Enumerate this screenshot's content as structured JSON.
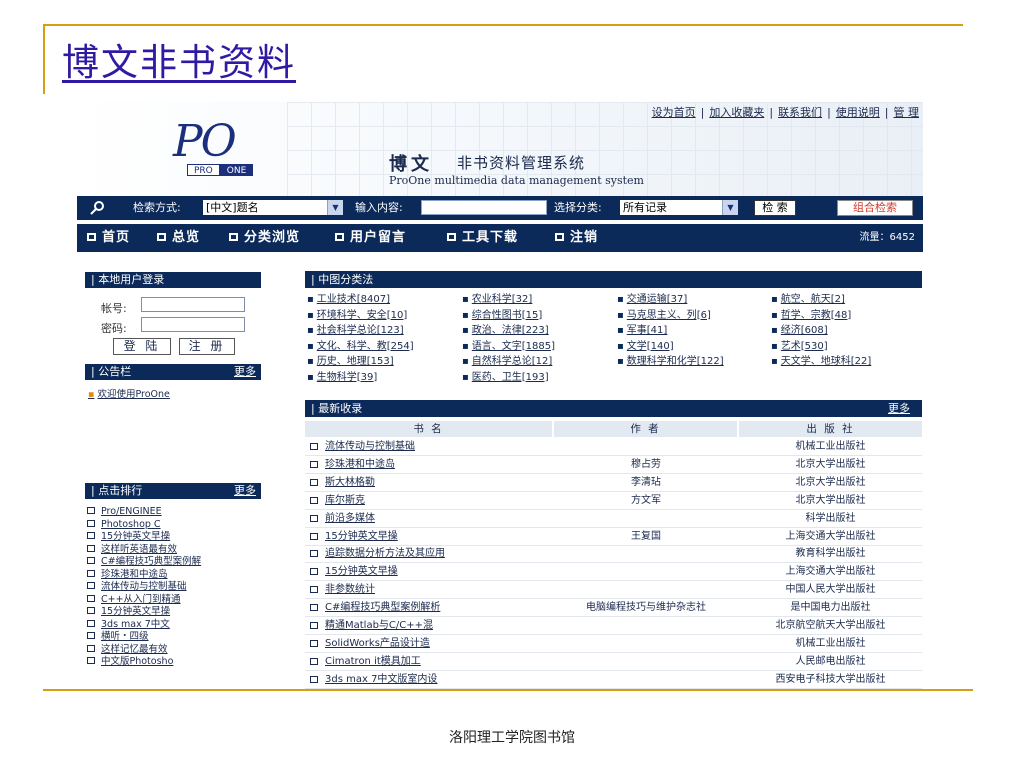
{
  "slide": {
    "title": "博文非书资料",
    "footer": "洛阳理工学院图书馆"
  },
  "app": {
    "logo_text": "PO",
    "logo_pro": "PRO",
    "logo_one": "ONE",
    "brand_name": "博文",
    "brand_subtitle": "非书资料管理系统",
    "brand_english": "ProOne  multimedia data management system",
    "top_links": [
      "设为首页",
      "加入收藏夹",
      "联系我们",
      "使用说明",
      "管 理"
    ]
  },
  "search": {
    "mode_label": "检索方式:",
    "mode_value": "[中文]题名",
    "input_label": "输入内容:",
    "input_value": "",
    "category_label": "选择分类:",
    "category_value": "所有记录",
    "search_button": "检 索",
    "combo_button": "组合检索"
  },
  "nav": {
    "items": [
      "首页",
      "总览",
      "分类浏览",
      "用户留言",
      "工具下载",
      "注销"
    ],
    "traffic": "流量：6452"
  },
  "login": {
    "header": "本地用户登录",
    "account_label": "帐号:",
    "password_label": "密码:",
    "login_button": "登 陆",
    "register_button": "注 册"
  },
  "notice": {
    "header": "公告栏",
    "more": "更多",
    "items": [
      "欢迎使用ProOne"
    ]
  },
  "ranking": {
    "header": "点击排行",
    "more": "更多",
    "items": [
      "Pro/ENGINEE",
      "Photoshop C",
      "15分钟英文早操",
      "这样听英语最有效",
      "C#编程技巧典型案例解",
      "珍珠港和中途岛",
      "流体传动与控制基础",
      "C++从入门到精通",
      "15分钟英文早操",
      "3ds max 7中文",
      "横听・四级",
      "这样记忆最有效",
      "中文版Photosho"
    ]
  },
  "categories": {
    "header": "中图分类法",
    "items": [
      "工业技术[8407]",
      "农业科学[32]",
      "交通运输[37]",
      "航空、航天[2]",
      "环境科学、安全[10]",
      "综合性图书[15]",
      "马克思主义、列[6]",
      "哲学、宗教[48]",
      "社会科学总论[123]",
      "政治、法律[223]",
      "军事[41]",
      "经济[608]",
      "文化、科学、教[254]",
      "语言、文字[1885]",
      "文学[140]",
      "艺术[530]",
      "历史、地理[153]",
      "自然科学总论[12]",
      "数理科学和化学[122]",
      "天文学、地球科[22]",
      "生物科学[39]",
      "医药、卫生[193]"
    ]
  },
  "latest": {
    "header": "最新收录",
    "more": "更多",
    "columns": {
      "title": "书 名",
      "author": "作 者",
      "publisher": "出 版 社"
    },
    "rows": [
      {
        "title": "流体传动与控制基础",
        "author": "",
        "publisher": "机械工业出版社"
      },
      {
        "title": "珍珠港和中途岛",
        "author": "穆占劳",
        "publisher": "北京大学出版社"
      },
      {
        "title": "斯大林格勒",
        "author": "李清玷",
        "publisher": "北京大学出版社"
      },
      {
        "title": "库尔斯克",
        "author": "方文军",
        "publisher": "北京大学出版社"
      },
      {
        "title": "前沿多媒体",
        "author": "",
        "publisher": "科学出版社"
      },
      {
        "title": "15分钟英文早操",
        "author": "王复国",
        "publisher": "上海交通大学出版社"
      },
      {
        "title": "追踪数据分析方法及其应用",
        "author": "",
        "publisher": "教育科学出版社"
      },
      {
        "title": "15分钟英文早操",
        "author": "",
        "publisher": "上海交通大学出版社"
      },
      {
        "title": "非参数统计",
        "author": "",
        "publisher": "中国人民大学出版社"
      },
      {
        "title": "C#编程技巧典型案例解析",
        "author": "电脑编程技巧与维护杂志社",
        "publisher": "是中国电力出版社"
      },
      {
        "title": "精通Matlab与C/C++混",
        "author": "",
        "publisher": "北京航空航天大学出版社"
      },
      {
        "title": "SolidWorks产品设计造",
        "author": "",
        "publisher": "机械工业出版社"
      },
      {
        "title": "Cimatron it模具加工",
        "author": "",
        "publisher": "人民邮电出版社"
      },
      {
        "title": "3ds max 7中文版室内设",
        "author": "",
        "publisher": "西安电子科技大学出版社"
      }
    ]
  },
  "colors": {
    "accent_gold": "#d79e12",
    "title_blue": "#2f1aa3",
    "bar_navy": "#0c2a59",
    "combo_red": "#d13a2b"
  }
}
